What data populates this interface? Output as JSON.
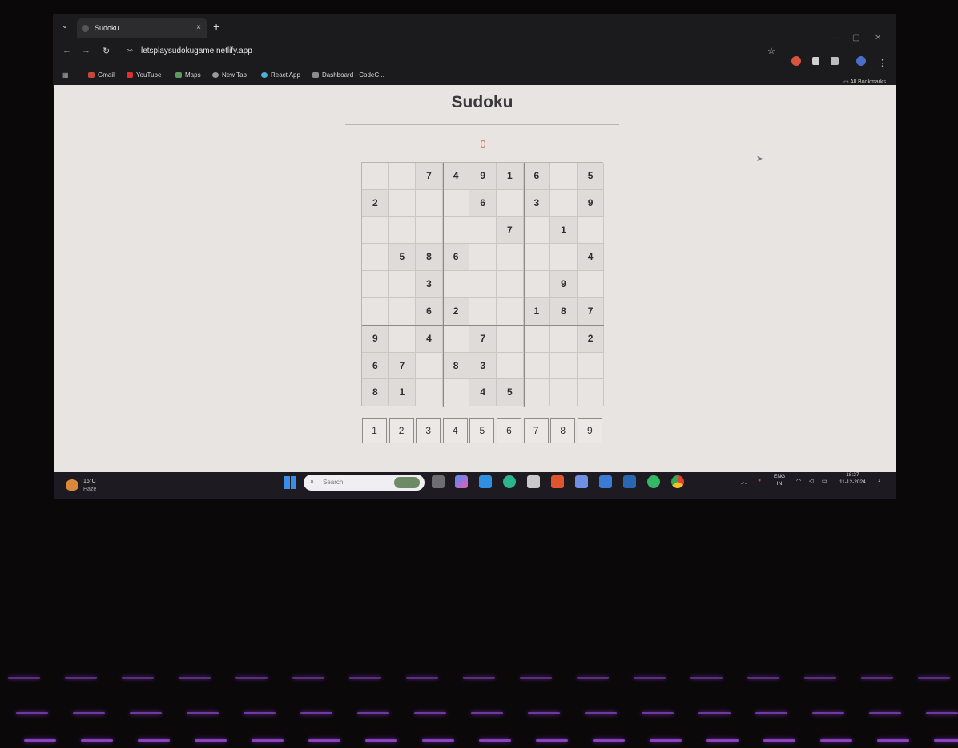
{
  "browser": {
    "tab_title": "Sudoku",
    "tab_close": "×",
    "new_tab": "+",
    "tab_list": "⌄",
    "url": "letsplaysudokugame.netlify.app",
    "bookmarks": [
      {
        "label": "Gmail",
        "color": "#c8473b"
      },
      {
        "label": "YouTube",
        "color": "#d8322a"
      },
      {
        "label": "Maps",
        "color": "#5b9a5e"
      },
      {
        "label": "New Tab",
        "color": "#9a9a9a"
      },
      {
        "label": "React App",
        "color": "#4bb3d8"
      },
      {
        "label": "Dashboard - CodeC...",
        "color": "#8b8b8b"
      }
    ],
    "all_bookmarks": "All Bookmarks"
  },
  "game": {
    "title": "Sudoku",
    "mistakes": "0",
    "grid": [
      [
        "",
        "",
        "7",
        "4",
        "9",
        "1",
        "6",
        "",
        "5"
      ],
      [
        "2",
        "",
        "",
        "",
        "6",
        "",
        "3",
        "",
        "9"
      ],
      [
        "",
        "",
        "",
        "",
        "",
        "7",
        "",
        "1",
        ""
      ],
      [
        "",
        "5",
        "8",
        "6",
        "",
        "",
        "",
        "",
        "4"
      ],
      [
        "",
        "",
        "3",
        "",
        "",
        "",
        "",
        "9",
        ""
      ],
      [
        "",
        "",
        "6",
        "2",
        "",
        "",
        "1",
        "8",
        "7"
      ],
      [
        "9",
        "",
        "4",
        "",
        "7",
        "",
        "",
        "",
        "2"
      ],
      [
        "6",
        "7",
        "",
        "8",
        "3",
        "",
        "",
        "",
        ""
      ],
      [
        "8",
        "1",
        "",
        "",
        "4",
        "5",
        "",
        "",
        ""
      ]
    ],
    "number_pad": [
      "1",
      "2",
      "3",
      "4",
      "5",
      "6",
      "7",
      "8",
      "9"
    ]
  },
  "taskbar": {
    "weather_temp": "16°C",
    "weather_condition": "Haze",
    "search_placeholder": "Search",
    "language_top": "ENG",
    "language_bottom": "IN",
    "time": "18:27",
    "date": "11-12-2024"
  }
}
